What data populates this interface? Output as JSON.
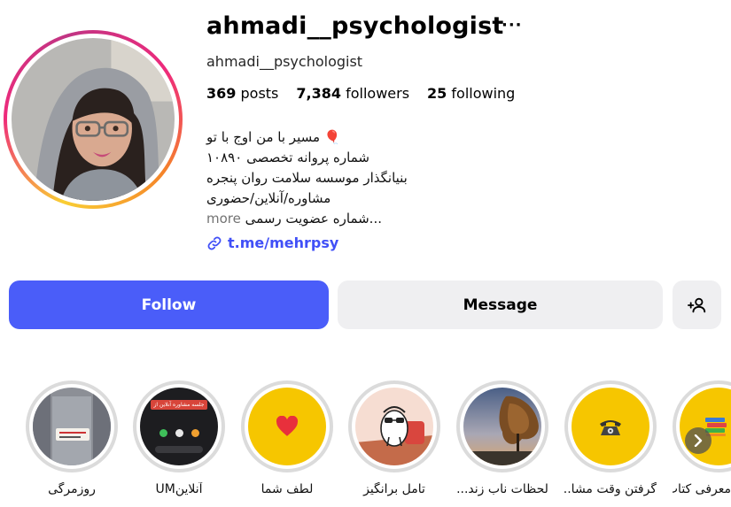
{
  "profile": {
    "username": "ahmadi__psychologist",
    "full_name": "ahmadi__psychologist",
    "more_label": "···",
    "stats": {
      "posts_count": "369",
      "posts_label": "posts",
      "followers_count": "7,384",
      "followers_label": "followers",
      "following_count": "25",
      "following_label": "following"
    },
    "bio": {
      "line1": "🎈 مسیر با من اوج با تو",
      "line2": "شماره پروانه تخصصی ۱۰۸۹۰",
      "line3": "بنیانگذار موسسه سلامت روان پنجره",
      "line4": "مشاوره/آنلاین/حضوری",
      "line5": "...شماره عضویت رسمی",
      "more": "more"
    },
    "link": "t.me/mehrpsy"
  },
  "actions": {
    "follow": "Follow",
    "message": "Message"
  },
  "highlights": [
    {
      "label": "روزمرگی",
      "icon": "photo"
    },
    {
      "label": "آنلاینUM",
      "icon": "screenshot",
      "caption": "جلسه مشاوره آنلاین از الان"
    },
    {
      "label": "لطف شما",
      "icon": "heart"
    },
    {
      "label": "تامل برانگیز",
      "icon": "cartoon"
    },
    {
      "label": "لحظات ناب زند...",
      "icon": "sunset-tree"
    },
    {
      "label": "گرفتن وقت مشا...",
      "icon": "telephone"
    },
    {
      "label": "معرفی کتاب",
      "icon": "books"
    }
  ],
  "colors": {
    "follow_button": "#4a5df9",
    "secondary_button": "#efeff1",
    "link": "#4150f7",
    "highlight_yellow": "#f6c600"
  }
}
